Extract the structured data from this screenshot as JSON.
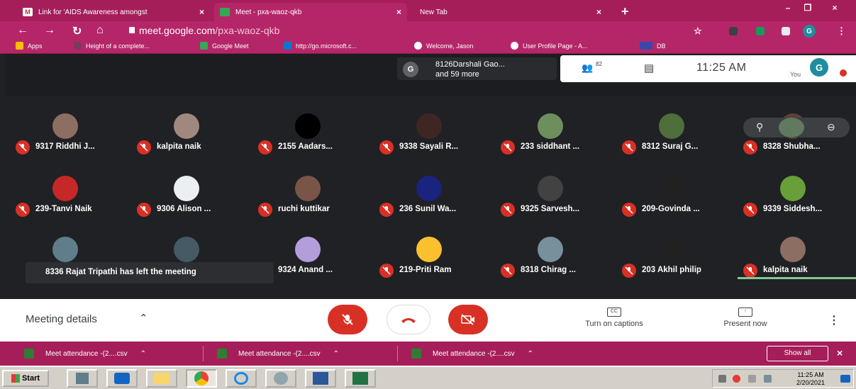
{
  "browser": {
    "tabs": [
      {
        "title": "Link for 'AIDS Awareness amongst",
        "favicon": "gmail-icon"
      },
      {
        "title": "Meet - pxa-waoz-qkb",
        "favicon": "meet-icon"
      },
      {
        "title": "New Tab",
        "favicon": ""
      }
    ],
    "url_host": "meet.google.com",
    "url_path": "/pxa-waoz-qkb",
    "profile_initial": "G",
    "bookmarks": [
      {
        "label": "Apps",
        "icon": "apps-grid-icon"
      },
      {
        "label": "Height of a complete...",
        "icon": "page-icon"
      },
      {
        "label": "Google Meet",
        "icon": "meet-icon"
      },
      {
        "label": "http://go.microsoft.c...",
        "icon": "bing-icon"
      },
      {
        "label": "Welcome, Jason",
        "icon": "github-icon"
      },
      {
        "label": "User Profile Page - A...",
        "icon": "github-icon"
      },
      {
        "label": "DB",
        "icon": "db-icon"
      }
    ]
  },
  "meet": {
    "presenter": {
      "initial": "G",
      "line1": "8126Darshali Gao...",
      "line2": "and 59 more"
    },
    "people_count": "82",
    "time": "11:25 AM",
    "you_label": "You",
    "you_initial": "G",
    "participants": [
      [
        "9317 Riddhi J...",
        "kalpita naik",
        "2155 Aadars...",
        "9338 Sayali R...",
        "233 siddhant ...",
        "8312 Suraj G...",
        "8328 Shubha..."
      ],
      [
        "239-Tanvi Naik",
        "9306 Alison ...",
        "ruchi kuttikar",
        "236 Sunil Wa...",
        "9325 Sarvesh...",
        "209-Govinda ...",
        "9339 Siddesh..."
      ],
      [
        "",
        "",
        "9324 Anand ...",
        "219-Priti Ram",
        "8318 Chirag ...",
        "203 Akhil philip",
        "kalpita naik"
      ]
    ],
    "toast": "8336 Rajat Tripathi has left the meeting",
    "controls": {
      "meeting_details": "Meeting details",
      "captions": "Turn on captions",
      "present": "Present now"
    }
  },
  "downloads": {
    "items": [
      "Meet attendance -(2....csv",
      "Meet attendance -(2....csv",
      "Meet attendance -(2....csv"
    ],
    "show_all": "Show all"
  },
  "taskbar": {
    "start": "Start",
    "time": "11:25 AM",
    "date": "2/20/2021"
  },
  "colors": {
    "chrome_theme": "#a51e5a",
    "meet_bg": "#202124",
    "mute_red": "#d93025"
  }
}
